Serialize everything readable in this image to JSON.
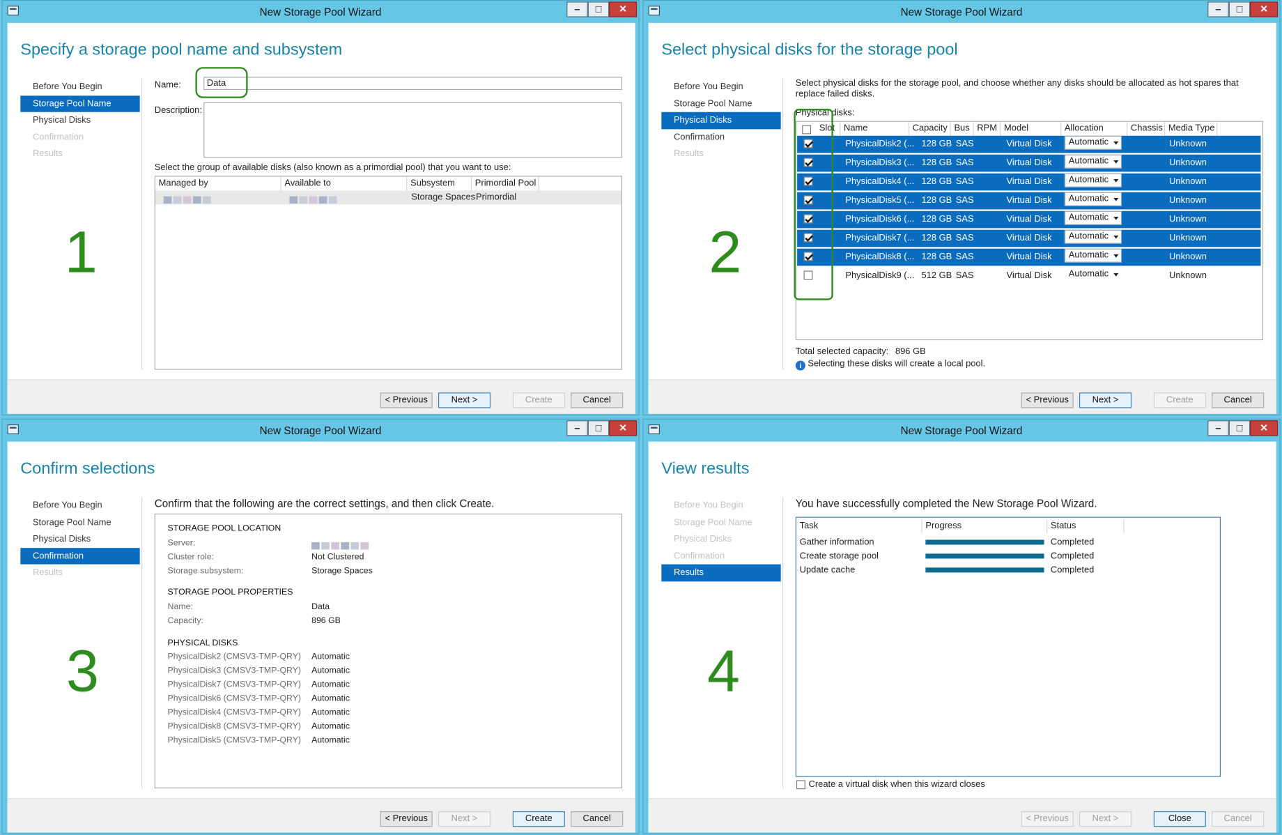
{
  "title": "New Storage Pool Wizard",
  "win_min": "–",
  "win_max": "□",
  "win_close": "✕",
  "nav": [
    "Before You Begin",
    "Storage Pool Name",
    "Physical Disks",
    "Confirmation",
    "Results"
  ],
  "buttons": {
    "prev": "< Previous",
    "next": "Next >",
    "create": "Create",
    "cancel": "Cancel",
    "close": "Close"
  },
  "w1": {
    "heading": "Specify a storage pool name and subsystem",
    "number": "1",
    "name_label": "Name:",
    "name_value": "Data",
    "desc_label": "Description:",
    "group_prompt": "Select the group of available disks (also known as a primordial pool) that you want to use:",
    "columns": [
      "Managed by",
      "Available to",
      "Subsystem",
      "Primordial Pool"
    ],
    "row": {
      "subsystem": "Storage Spaces",
      "primordial": "Primordial"
    }
  },
  "w2": {
    "heading": "Select physical disks for the storage pool",
    "number": "2",
    "intro": "Select physical disks for the storage pool, and choose whether any disks should be allocated as hot spares that replace failed disks.",
    "group_label": "Physical disks:",
    "columns": [
      "Slot",
      "Name",
      "Capacity",
      "Bus",
      "RPM",
      "Model",
      "Allocation",
      "Chassis",
      "Media Type"
    ],
    "disks": [
      {
        "name": "PhysicalDisk2 (...",
        "capacity": "128 GB",
        "bus": "SAS",
        "model": "Virtual Disk",
        "allocation": "Automatic",
        "media": "Unknown",
        "checked": true
      },
      {
        "name": "PhysicalDisk3 (...",
        "capacity": "128 GB",
        "bus": "SAS",
        "model": "Virtual Disk",
        "allocation": "Automatic",
        "media": "Unknown",
        "checked": true
      },
      {
        "name": "PhysicalDisk4 (...",
        "capacity": "128 GB",
        "bus": "SAS",
        "model": "Virtual Disk",
        "allocation": "Automatic",
        "media": "Unknown",
        "checked": true
      },
      {
        "name": "PhysicalDisk5 (...",
        "capacity": "128 GB",
        "bus": "SAS",
        "model": "Virtual Disk",
        "allocation": "Automatic",
        "media": "Unknown",
        "checked": true
      },
      {
        "name": "PhysicalDisk6 (...",
        "capacity": "128 GB",
        "bus": "SAS",
        "model": "Virtual Disk",
        "allocation": "Automatic",
        "media": "Unknown",
        "checked": true
      },
      {
        "name": "PhysicalDisk7 (...",
        "capacity": "128 GB",
        "bus": "SAS",
        "model": "Virtual Disk",
        "allocation": "Automatic",
        "media": "Unknown",
        "checked": true
      },
      {
        "name": "PhysicalDisk8 (...",
        "capacity": "128 GB",
        "bus": "SAS",
        "model": "Virtual Disk",
        "allocation": "Automatic",
        "media": "Unknown",
        "checked": true
      },
      {
        "name": "PhysicalDisk9 (...",
        "capacity": "512 GB",
        "bus": "SAS",
        "model": "Virtual Disk",
        "allocation": "Automatic",
        "media": "Unknown",
        "checked": false
      }
    ],
    "total_label": "Total selected capacity:",
    "total_value": "896 GB",
    "info_text": "Selecting these disks will create a local pool."
  },
  "w3": {
    "heading": "Confirm selections",
    "number": "3",
    "intro": "Confirm that the following are the correct settings, and then click Create.",
    "loc_title": "STORAGE POOL LOCATION",
    "server_label": "Server:",
    "cluster_label": "Cluster role:",
    "cluster_value": "Not Clustered",
    "subsys_label": "Storage subsystem:",
    "subsys_value": "Storage Spaces",
    "prop_title": "STORAGE POOL PROPERTIES",
    "name_label": "Name:",
    "name_value": "Data",
    "cap_label": "Capacity:",
    "cap_value": "896 GB",
    "disks_title": "PHYSICAL DISKS",
    "disks": [
      {
        "name": "PhysicalDisk2 (CMSV3-TMP-QRY)",
        "alloc": "Automatic"
      },
      {
        "name": "PhysicalDisk3 (CMSV3-TMP-QRY)",
        "alloc": "Automatic"
      },
      {
        "name": "PhysicalDisk7 (CMSV3-TMP-QRY)",
        "alloc": "Automatic"
      },
      {
        "name": "PhysicalDisk6 (CMSV3-TMP-QRY)",
        "alloc": "Automatic"
      },
      {
        "name": "PhysicalDisk4 (CMSV3-TMP-QRY)",
        "alloc": "Automatic"
      },
      {
        "name": "PhysicalDisk8 (CMSV3-TMP-QRY)",
        "alloc": "Automatic"
      },
      {
        "name": "PhysicalDisk5 (CMSV3-TMP-QRY)",
        "alloc": "Automatic"
      }
    ]
  },
  "w4": {
    "heading": "View results",
    "number": "4",
    "intro": "You have successfully completed the New Storage Pool Wizard.",
    "columns": [
      "Task",
      "Progress",
      "Status"
    ],
    "tasks": [
      {
        "task": "Gather information",
        "progress": 1.0,
        "status": "Completed"
      },
      {
        "task": "Create storage pool",
        "progress": 1.0,
        "status": "Completed"
      },
      {
        "task": "Update cache",
        "progress": 1.0,
        "status": "Completed"
      }
    ],
    "checkbox_label": "Create a virtual disk when this wizard closes"
  },
  "colors": {
    "accent": "#0a6cbf",
    "heading": "#1a82a8",
    "annotation": "#2e8b1e",
    "frame": "#66c6e6",
    "progress": "#0a6a8f"
  },
  "icons": {
    "app": "storage-pool-wizard-icon",
    "info": "info-icon",
    "dropdown": "chevron-down-icon"
  }
}
